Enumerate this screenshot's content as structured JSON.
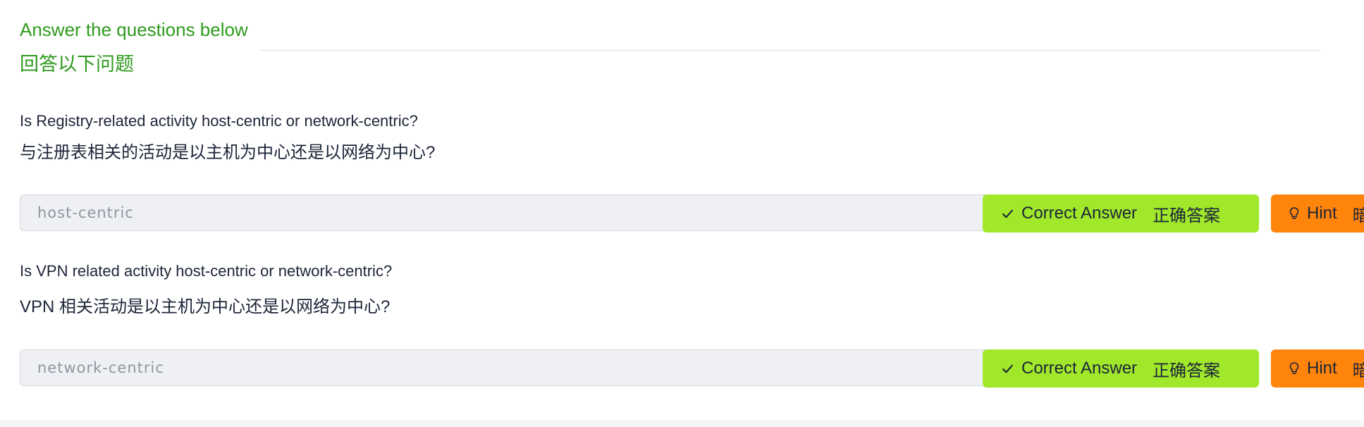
{
  "header": {
    "title_en": "Answer the questions below",
    "title_zh": "回答以下问题"
  },
  "questions": [
    {
      "text_en": "Is Registry-related activity host-centric or network-centric?",
      "text_zh": "与注册表相关的活动是以主机为中心还是以网络为中心?",
      "answer_value": "host-centric",
      "correct_label_en": "Correct Answer",
      "correct_label_zh": "正确答案",
      "correct_icon": "check-icon",
      "hint_label_en": "Hint",
      "hint_label_zh": "暗示",
      "hint_icon": "lightbulb-icon"
    },
    {
      "text_en": "Is VPN related activity host-centric or network-centric?",
      "text_zh": "VPN 相关活动是以主机为中心还是以网络为中心?",
      "answer_value": "network-centric",
      "correct_label_en": "Correct Answer",
      "correct_label_zh": "正确答案",
      "correct_icon": "check-icon",
      "hint_label_en": "Hint",
      "hint_label_zh": "暗示",
      "hint_icon": "lightbulb-icon"
    }
  ],
  "colors": {
    "heading_green": "#2f9a1e",
    "correct_button": "#a1e82b",
    "hint_button": "#ff840c",
    "input_background": "#eef0f3",
    "text_dark": "#1c2538"
  }
}
